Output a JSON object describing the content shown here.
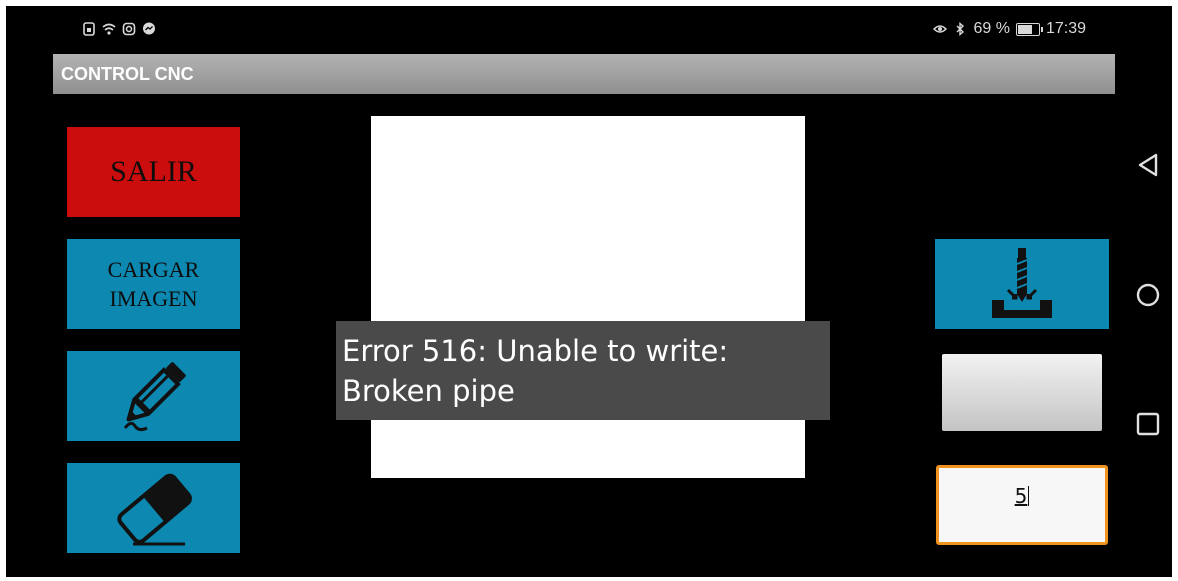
{
  "status_bar": {
    "icons_left": [
      "sim-icon",
      "wifi-icon",
      "instagram-icon",
      "messenger-icon"
    ],
    "icons_right": [
      "eye-icon",
      "bluetooth-icon"
    ],
    "battery_percent": "69 %",
    "battery_level": 0.69,
    "time": "17:39"
  },
  "app": {
    "title": "CONTROL CNC"
  },
  "left_panel": {
    "exit_label": "SALIR",
    "load_image_line1": "CARGAR",
    "load_image_line2": "IMAGEN",
    "draw_icon": "pencil-icon",
    "erase_icon": "eraser-icon"
  },
  "toast": {
    "line1": "Error 516: Unable to write:",
    "line2": "Broken pipe"
  },
  "right_panel": {
    "tool_icon": "cnc-bit-icon",
    "value": "5"
  },
  "nav_bar": {
    "icons": [
      "back-icon",
      "home-icon",
      "recents-icon"
    ]
  },
  "colors": {
    "background": "#000000",
    "exit_button": "#cc0d0d",
    "accent_button": "#0d88b0",
    "title_bar": "#a3a3a3",
    "input_border": "#f0921e",
    "toast_bg": "#4a4a4a"
  }
}
